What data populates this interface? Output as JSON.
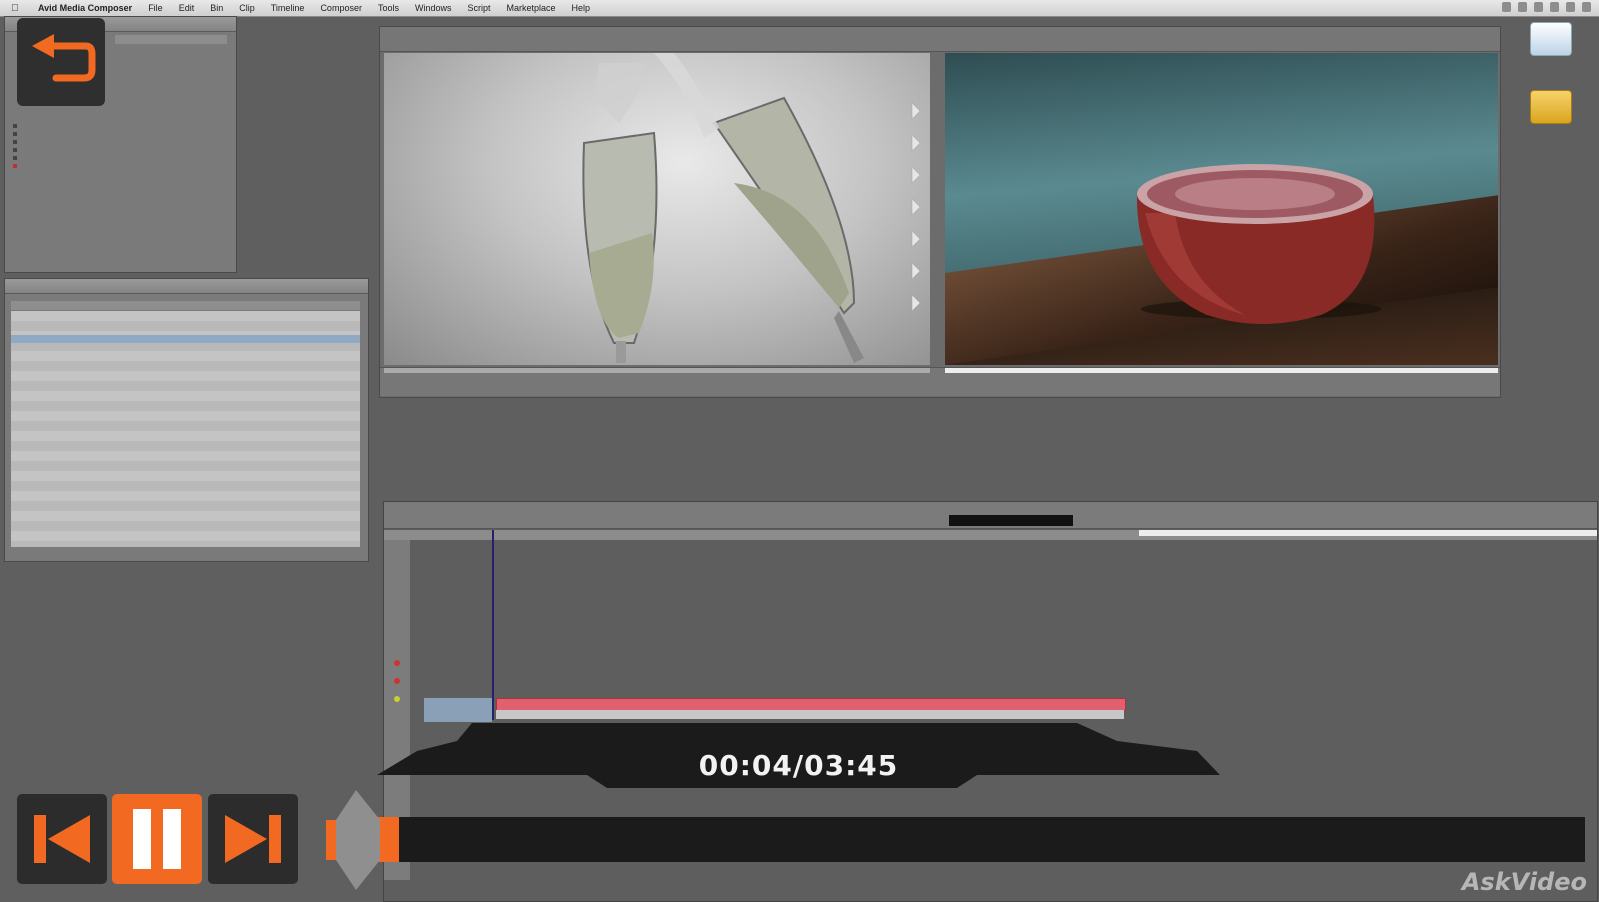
{
  "menubar": {
    "apple": "",
    "items": [
      "Avid Media Composer",
      "File",
      "Edit",
      "Bin",
      "Clip",
      "Timeline",
      "Composer",
      "Tools",
      "Windows",
      "Script",
      "Marketplace",
      "Help"
    ]
  },
  "player": {
    "time": "00:04/03:45",
    "progress": 0.018,
    "accent": "#f26a21",
    "icons": {
      "back": "undo-arrow-icon",
      "prev": "skip-previous-icon",
      "pause": "pause-icon",
      "next": "skip-next-icon"
    }
  },
  "watermark": "AskVideo",
  "colors": {
    "clip": "#e06070",
    "selection": "#8fa8c4"
  }
}
